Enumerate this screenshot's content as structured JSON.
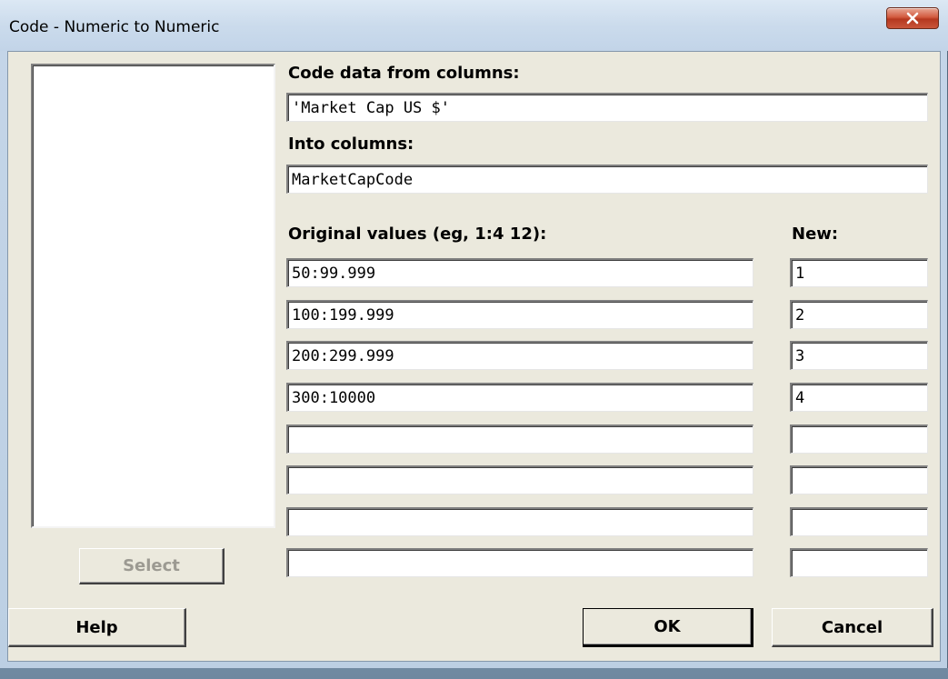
{
  "window": {
    "title": "Code - Numeric to Numeric",
    "close_icon": "close-x-icon"
  },
  "labels": {
    "code_from": "Code data from columns:",
    "into": "Into columns:",
    "original": "Original values (eg,  1:4  12):",
    "new": "New:"
  },
  "fields": {
    "code_from_value": "'Market Cap US $'",
    "into_value": "MarketCapCode"
  },
  "rows": [
    {
      "original": "50:99.999",
      "new": "1"
    },
    {
      "original": "100:199.999",
      "new": "2"
    },
    {
      "original": "200:299.999",
      "new": "3"
    },
    {
      "original": "300:10000",
      "new": "4"
    },
    {
      "original": "",
      "new": ""
    },
    {
      "original": "",
      "new": ""
    },
    {
      "original": "",
      "new": ""
    },
    {
      "original": "",
      "new": ""
    }
  ],
  "buttons": {
    "select": "Select",
    "help": "Help",
    "ok": "OK",
    "cancel": "Cancel"
  },
  "colors": {
    "dialog_face": "#ebe9dd",
    "close_button": "#c9553a"
  }
}
